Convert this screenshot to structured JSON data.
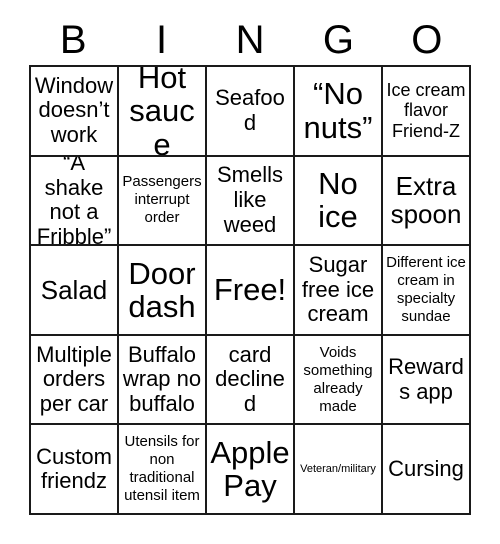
{
  "card": {
    "title_letters": [
      "B",
      "I",
      "N",
      "G",
      "O"
    ],
    "columns": 5,
    "rows": 5,
    "free_space_label": "Free!",
    "colors": {
      "background": "#ffffff",
      "text": "#000000",
      "grid_line": "#1a1a1a"
    },
    "cells": [
      {
        "text": "Window doesn’t work",
        "size": "md"
      },
      {
        "text": "Hot sauce",
        "size": "xl"
      },
      {
        "text": "Seafood",
        "size": "md"
      },
      {
        "text": "“No nuts”",
        "size": "xl"
      },
      {
        "text": "Ice cream flavor Friend-Z",
        "size": "sm"
      },
      {
        "text": "“A shake not a Fribble”",
        "size": "md"
      },
      {
        "text": "Passengers interrupt order",
        "size": "xs"
      },
      {
        "text": "Smells like weed",
        "size": "md"
      },
      {
        "text": "No ice",
        "size": "xl"
      },
      {
        "text": "Extra spoon",
        "size": "lg"
      },
      {
        "text": "Salad",
        "size": "lg"
      },
      {
        "text": "Door dash",
        "size": "xl"
      },
      {
        "text": "Free!",
        "size": "xl"
      },
      {
        "text": "Sugar free ice cream",
        "size": "md"
      },
      {
        "text": "Different ice cream in specialty sundae",
        "size": "xs"
      },
      {
        "text": "Multiple orders per car",
        "size": "md"
      },
      {
        "text": "Buffalo wrap no buffalo",
        "size": "md"
      },
      {
        "text": "card declined",
        "size": "md"
      },
      {
        "text": "Voids something already made",
        "size": "xs"
      },
      {
        "text": "Rewards app",
        "size": "md"
      },
      {
        "text": "Custom friendz",
        "size": "md"
      },
      {
        "text": "Utensils for non traditional utensil item",
        "size": "xs"
      },
      {
        "text": "Apple Pay",
        "size": "xl"
      },
      {
        "text": "Veteran/military",
        "size": "xxs"
      },
      {
        "text": "Cursing",
        "size": "md"
      }
    ]
  }
}
